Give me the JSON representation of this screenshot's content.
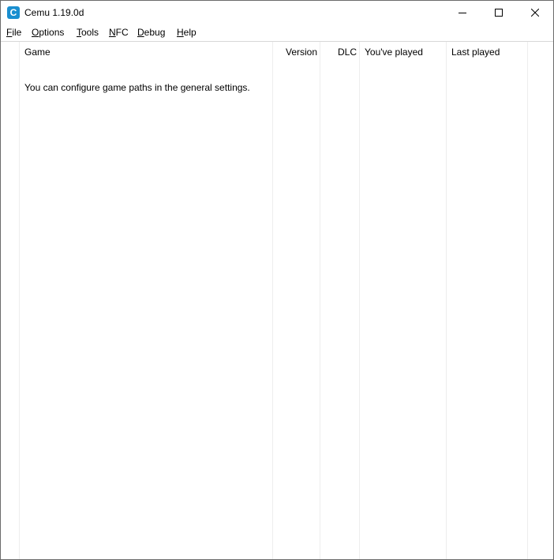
{
  "window": {
    "title": "Cemu 1.19.0d",
    "icon_letter": "C",
    "controls": [
      "minimize-icon",
      "maximize-icon",
      "close-icon"
    ]
  },
  "menu": {
    "items": [
      {
        "label": "File",
        "accel": "F",
        "rest": "ile"
      },
      {
        "label": "Options",
        "accel": "O",
        "rest": "ptions"
      },
      {
        "label": "Tools",
        "accel": "T",
        "rest": "ools"
      },
      {
        "label": "NFC",
        "accel": "N",
        "rest": "FC"
      },
      {
        "label": "Debug",
        "accel": "D",
        "rest": "ebug"
      },
      {
        "label": "Help",
        "accel": "H",
        "rest": "elp"
      }
    ]
  },
  "game_list": {
    "columns": [
      "Game",
      "Version",
      "DLC",
      "You've played",
      "Last played"
    ],
    "empty_message": "You can configure game paths in the general settings."
  }
}
